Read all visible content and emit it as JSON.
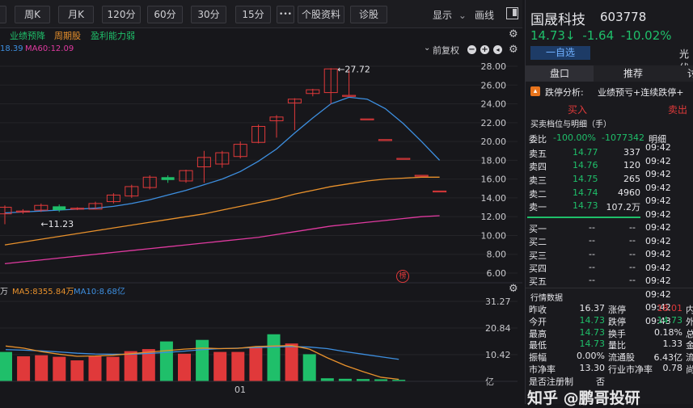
{
  "toolbar": {
    "periods": [
      "周K",
      "月K",
      "120分",
      "60分",
      "30分",
      "15分"
    ],
    "more_label": "•••",
    "profile_label": "个股资料",
    "diagnose_label": "诊股",
    "display_label": "显示",
    "draw_label": "画线"
  },
  "tags": {
    "tag1": "业绩预降",
    "tag2": "周期股",
    "tag3": "盈利能力弱"
  },
  "ma_legend": {
    "ma_partial": "18.39",
    "ma60": "MA60:12.09",
    "adjust_label": "前复权"
  },
  "chart_data": {
    "type": "candlestick",
    "price_axis": [
      "28.00",
      "26.00",
      "24.00",
      "22.00",
      "20.00",
      "18.00",
      "16.00",
      "14.00",
      "12.00",
      "10.00",
      "8.00",
      "6.00"
    ],
    "ylim": [
      6,
      28
    ],
    "candles": [
      {
        "o": 12.3,
        "c": 13.0,
        "h": 13.2,
        "l": 11.2
      },
      {
        "o": 12.5,
        "c": 12.6,
        "h": 12.8,
        "l": 12.3
      },
      {
        "o": 12.7,
        "c": 13.2,
        "h": 13.4,
        "l": 12.5
      },
      {
        "o": 13.1,
        "c": 12.7,
        "h": 13.3,
        "l": 12.5
      },
      {
        "o": 12.8,
        "c": 12.9,
        "h": 13.0,
        "l": 12.7
      },
      {
        "o": 12.8,
        "c": 13.4,
        "h": 13.6,
        "l": 12.8
      },
      {
        "o": 13.6,
        "c": 14.3,
        "h": 14.5,
        "l": 13.4
      },
      {
        "o": 14.2,
        "c": 15.2,
        "h": 15.4,
        "l": 14.0
      },
      {
        "o": 15.1,
        "c": 16.2,
        "h": 16.4,
        "l": 14.9
      },
      {
        "o": 16.2,
        "c": 15.9,
        "h": 16.4,
        "l": 15.6
      },
      {
        "o": 15.8,
        "c": 16.9,
        "h": 17.0,
        "l": 15.6
      },
      {
        "o": 17.3,
        "c": 18.3,
        "h": 19.0,
        "l": 15.6
      },
      {
        "o": 17.6,
        "c": 18.8,
        "h": 19.0,
        "l": 17.2
      },
      {
        "o": 18.4,
        "c": 19.7,
        "h": 20.0,
        "l": 18.2
      },
      {
        "o": 19.9,
        "c": 21.6,
        "h": 21.8,
        "l": 19.8
      },
      {
        "o": 22.2,
        "c": 22.6,
        "h": 22.8,
        "l": 20.4
      },
      {
        "o": 24.1,
        "c": 24.5,
        "h": 24.6,
        "l": 21.2
      },
      {
        "o": 25.1,
        "c": 25.5,
        "h": 25.6,
        "l": 24.8
      },
      {
        "o": 25.2,
        "c": 27.72,
        "h": 27.8,
        "l": 24.0
      },
      {
        "o": 24.9,
        "c": 24.9,
        "h": 27.6,
        "l": 24.9
      },
      {
        "o": 22.4,
        "c": 22.4,
        "h": 22.4,
        "l": 22.4
      },
      {
        "o": 20.2,
        "c": 20.2,
        "h": 20.2,
        "l": 20.2
      },
      {
        "o": 18.2,
        "c": 18.2,
        "h": 18.2,
        "l": 18.2
      },
      {
        "o": 16.4,
        "c": 16.4,
        "h": 16.4,
        "l": 16.4
      },
      {
        "o": 14.73,
        "c": 14.73,
        "h": 14.73,
        "l": 14.73
      }
    ],
    "annotations": {
      "high": "27.72",
      "low": "11.23"
    },
    "ma_blue": [
      12.4,
      12.5,
      12.6,
      12.7,
      12.8,
      12.9,
      13.1,
      13.4,
      13.8,
      14.3,
      14.8,
      15.4,
      16.0,
      16.8,
      17.9,
      19.2,
      20.9,
      22.5,
      24.0,
      24.7,
      24.5,
      23.5,
      21.9,
      20.0,
      18.0
    ],
    "ma_orange": [
      9.0,
      9.3,
      9.6,
      9.9,
      10.2,
      10.5,
      10.8,
      11.1,
      11.4,
      11.7,
      12.0,
      12.3,
      12.7,
      13.1,
      13.5,
      13.9,
      14.4,
      14.8,
      15.2,
      15.5,
      15.8,
      16.0,
      16.1,
      16.2,
      16.2
    ],
    "ma_pink": [
      7.0,
      7.2,
      7.4,
      7.6,
      7.8,
      8.0,
      8.2,
      8.4,
      8.6,
      8.8,
      9.0,
      9.2,
      9.4,
      9.6,
      9.8,
      10.1,
      10.4,
      10.7,
      11.0,
      11.2,
      11.4,
      11.6,
      11.8,
      12.0,
      12.1
    ],
    "volume_axis": [
      "31.27",
      "20.84",
      "10.42",
      "亿"
    ],
    "volume_ylim": [
      0,
      31.27
    ],
    "volume": [
      {
        "v": 11.5,
        "up": false
      },
      {
        "v": 9.8,
        "up": true
      },
      {
        "v": 10.2,
        "up": true
      },
      {
        "v": 9.6,
        "up": true
      },
      {
        "v": 8.2,
        "up": true
      },
      {
        "v": 9.8,
        "up": true
      },
      {
        "v": 9.6,
        "up": true
      },
      {
        "v": 11.8,
        "up": true
      },
      {
        "v": 12.6,
        "up": true
      },
      {
        "v": 15.6,
        "up": false
      },
      {
        "v": 10.8,
        "up": true
      },
      {
        "v": 16.2,
        "up": false
      },
      {
        "v": 11.5,
        "up": true
      },
      {
        "v": 11.5,
        "up": true
      },
      {
        "v": 13.3,
        "up": true
      },
      {
        "v": 18.4,
        "up": false
      },
      {
        "v": 14.8,
        "up": true
      },
      {
        "v": 10.6,
        "up": false
      },
      {
        "v": 1.2,
        "up": false
      },
      {
        "v": 1.0,
        "up": false
      },
      {
        "v": 0.9,
        "up": false
      },
      {
        "v": 0.8,
        "up": false
      },
      {
        "v": 0.6,
        "up": false
      }
    ],
    "vol_ma_orange": [
      13.8,
      13.0,
      11.6,
      10.6,
      9.8,
      9.9,
      10.2,
      10.8,
      11.4,
      12.0,
      12.6,
      13.0,
      12.8,
      12.9,
      13.6,
      13.8,
      14.0,
      12.6,
      9.2,
      6.2,
      3.8,
      1.6,
      0.8
    ],
    "vol_ma_blue": [
      12.4,
      12.2,
      11.9,
      11.5,
      11.0,
      10.7,
      10.6,
      10.6,
      10.9,
      11.3,
      11.8,
      12.4,
      12.8,
      13.0,
      13.2,
      13.4,
      13.6,
      13.4,
      12.8,
      11.6,
      10.6,
      9.6,
      8.6
    ],
    "x_tick": "01"
  },
  "volume_legend": {
    "unit": "万",
    "ma5": "MA5:8355.84万",
    "ma10": "MA10:8.68亿"
  },
  "sidebar_mark": "榜",
  "stock": {
    "name": "国晟科技",
    "code": "603778",
    "price": "14.73",
    "arrow": "↓",
    "change": "-1.64",
    "change_pct": "-10.02%",
    "watch_button": "一自选",
    "extra": "光伏"
  },
  "right_tabs": {
    "tab1": "盘口",
    "tab2": "推荐",
    "tab3": "讨"
  },
  "analysis": {
    "label": "跌停分析:",
    "text": "业绩预亏+连续跌停+"
  },
  "trade": {
    "buy": "买入",
    "sell": "卖出"
  },
  "orderbook": {
    "title": "买卖档位与明细（手）",
    "ratio_label": "委比",
    "ratio_value": "-100.00%",
    "ratio_diff": "-1077342",
    "detail_label": "明细",
    "asks": [
      {
        "label": "卖五",
        "price": "14.77",
        "vol": "337"
      },
      {
        "label": "卖四",
        "price": "14.76",
        "vol": "120"
      },
      {
        "label": "卖三",
        "price": "14.75",
        "vol": "265"
      },
      {
        "label": "卖二",
        "price": "14.74",
        "vol": "4960"
      },
      {
        "label": "卖一",
        "price": "14.73",
        "vol": "107.2万"
      }
    ],
    "bids": [
      {
        "label": "买一",
        "price": "--",
        "vol": "--"
      },
      {
        "label": "买二",
        "price": "--",
        "vol": "--"
      },
      {
        "label": "买三",
        "price": "--",
        "vol": "--"
      },
      {
        "label": "买四",
        "price": "--",
        "vol": "--"
      },
      {
        "label": "买五",
        "price": "--",
        "vol": "--"
      }
    ],
    "times": [
      "09:42",
      "09:42",
      "09:42",
      "09:42",
      "09:42",
      "09:42",
      "09:42",
      "09:42",
      "09:42",
      "09:42",
      "09:42",
      "09:42",
      "09:42",
      "09:43"
    ]
  },
  "market": {
    "title": "行情数据",
    "rows": [
      {
        "l1": "昨收",
        "v1": "16.37",
        "l2": "涨停",
        "v2": "18.01",
        "l3": "内"
      },
      {
        "l1": "今开",
        "v1": "14.73",
        "l2": "跌停",
        "v2": "14.73",
        "l3": "外"
      },
      {
        "l1": "最高",
        "v1": "14.73",
        "l2": "换手",
        "v2": "0.18%",
        "l3": "总"
      },
      {
        "l1": "最低",
        "v1": "14.73",
        "l2": "量比",
        "v2": "1.33",
        "l3": "金"
      },
      {
        "l1": "振幅",
        "v1": "0.00%",
        "l2": "流通股",
        "v2": "6.43亿",
        "l3": "流"
      },
      {
        "l1": "市净率",
        "v1": "13.30",
        "l2": "行业市净率",
        "v2": "0.78",
        "l3": "尚"
      },
      {
        "l1": "是否注册制",
        "v1": "否",
        "l2": "",
        "v2": "",
        "l3": ""
      }
    ]
  },
  "watermark": "知乎 @鹏哥投研"
}
